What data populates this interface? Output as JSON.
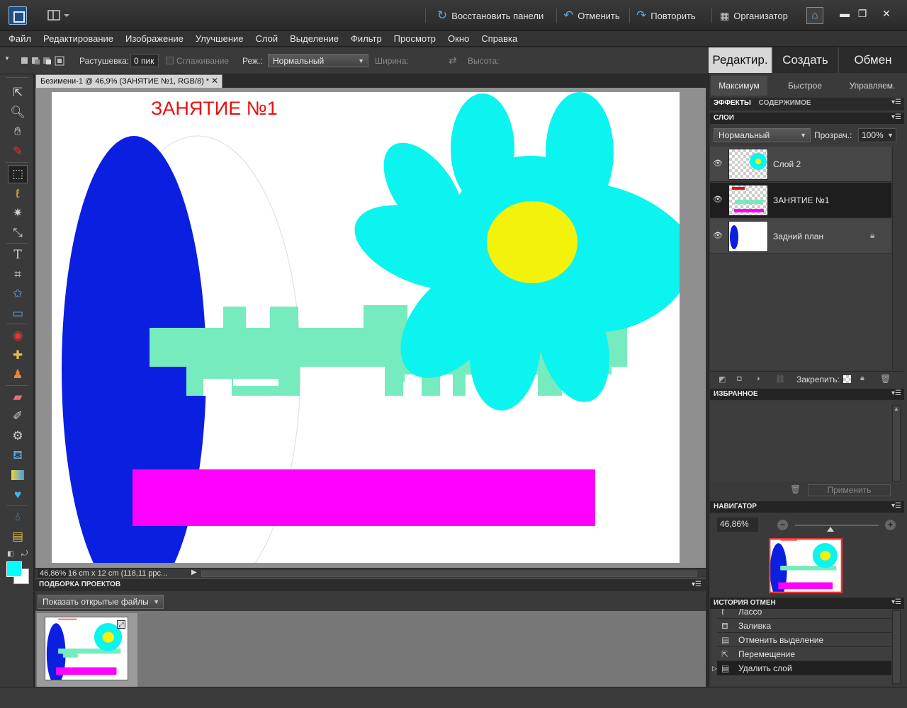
{
  "titlebar": {
    "restore_panels": "Восстановить панели",
    "undo": "Отменить",
    "redo": "Повторить",
    "organizer": "Организатор"
  },
  "menu": [
    "Файл",
    "Редактирование",
    "Изображение",
    "Улучшение",
    "Слой",
    "Выделение",
    "Фильтр",
    "Просмотр",
    "Окно",
    "Справка"
  ],
  "options": {
    "feather_label": "Растушевка:",
    "feather_value": "0 пик",
    "antialias_label": "Сглаживание",
    "mode_label": "Реж.:",
    "mode_value": "Нормальный",
    "width_label": "Ширина:",
    "height_label": "Высота:"
  },
  "document": {
    "tab_title": "Безимени-1 @ 46,9% (ЗАНЯТИЕ №1, RGB/8) *",
    "zoom": "46,86%",
    "doc_info": "16 cm x 12 cm (118,11 ppc..."
  },
  "canvas_art": {
    "heading": "ЗАНЯТИЕ №1",
    "colors": {
      "heading": "#e8100e",
      "ellipse": "#0a1fe0",
      "key": "#76ebbd",
      "petals": "#0cf4f0",
      "center": "#f2f20a",
      "bar": "#ff00ff"
    }
  },
  "project_bin": {
    "title": "ПОДБОРКА ПРОЕКТОВ",
    "show_value": "Показать открытые файлы"
  },
  "right_panel": {
    "tabs": [
      "Редактир.",
      "Создать",
      "Обмен"
    ],
    "subtabs": [
      "Максимум",
      "Быстрое",
      "Управляем."
    ],
    "effects_tab": "ЭФФЕКТЫ",
    "content_tab": "СОДЕРЖИМОЕ",
    "layers_title": "СЛОИ",
    "blend_mode": "Нормальный",
    "opacity_label": "Прозрач.:",
    "opacity_value": "100%",
    "layers": [
      {
        "name": "Слой 2"
      },
      {
        "name": "ЗАНЯТИЕ №1"
      },
      {
        "name": "Задний план"
      }
    ],
    "lock_label": "Закрепить:",
    "favorites_title": "ИЗБРАННОЕ",
    "apply_label": "Применить",
    "navigator_title": "НАВИГАТОР",
    "navigator_zoom": "46,86%",
    "history_title": "ИСТОРИЯ ОТМЕН",
    "history": [
      "Лассо",
      "Заливка",
      "Отменить выделение",
      "Перемещение",
      "Удалить слой"
    ]
  },
  "icons": {
    "undo": "undo-arrow-icon",
    "redo": "redo-arrow-icon",
    "restore": "refresh-icon",
    "organizer": "grid-icon",
    "home": "home-icon"
  }
}
